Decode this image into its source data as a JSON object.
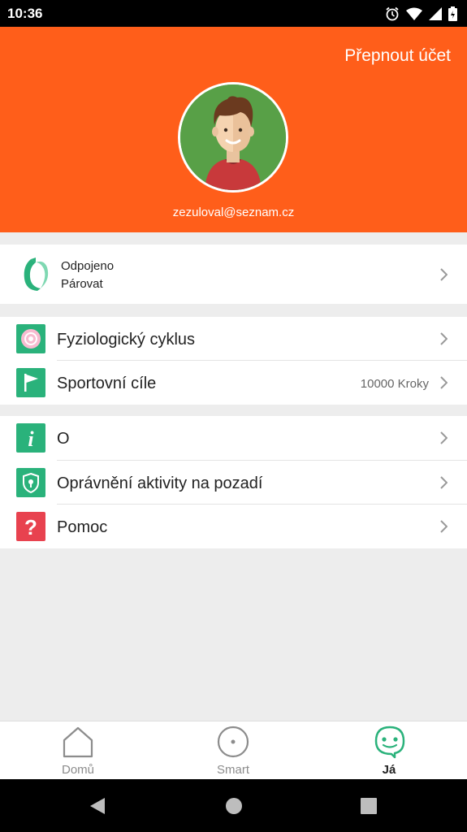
{
  "status_bar": {
    "time": "10:36"
  },
  "header": {
    "switch_account": "Přepnout účet",
    "email": "zezuloval@seznam.cz"
  },
  "device": {
    "status": "Odpojeno",
    "action": "Párovat"
  },
  "menu_group_1": [
    {
      "label": "Fyziologický cyklus"
    },
    {
      "label": "Sportovní cíle",
      "value": "10000 Kroky"
    }
  ],
  "menu_group_2": [
    {
      "label": "O"
    },
    {
      "label": "Oprávnění aktivity na pozadí"
    },
    {
      "label": "Pomoc"
    }
  ],
  "bottom_nav": [
    {
      "label": "Domů",
      "icon": "home-icon",
      "active": false
    },
    {
      "label": "Smart",
      "icon": "smart-circle-icon",
      "active": false
    },
    {
      "label": "Já",
      "icon": "face-icon",
      "active": true
    }
  ],
  "colors": {
    "header": "#ff5e1a",
    "accent_green": "#2ab27b",
    "help_red": "#e8424f",
    "cycle_pink": "#f48fb1"
  }
}
